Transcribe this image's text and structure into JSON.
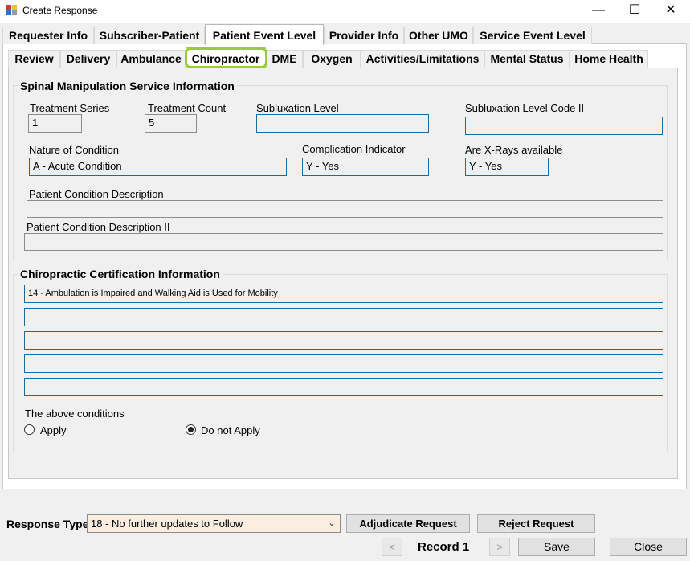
{
  "window": {
    "title": "Create Response",
    "minimize_glyph": "—",
    "maximize_glyph": "☐",
    "close_glyph": "✕",
    "icon": "app-window-icon"
  },
  "top_tabs": [
    {
      "label": "Requester Info",
      "active": false
    },
    {
      "label": "Subscriber-Patient",
      "active": false
    },
    {
      "label": "Patient Event Level",
      "active": true
    },
    {
      "label": "Provider Info",
      "active": false
    },
    {
      "label": "Other UMO",
      "active": false
    },
    {
      "label": "Service Event Level",
      "active": false
    }
  ],
  "sub_tabs": [
    {
      "label": "Review",
      "active": false
    },
    {
      "label": "Delivery",
      "active": false
    },
    {
      "label": "Ambulance",
      "active": false
    },
    {
      "label": "Chiropractor",
      "active": true
    },
    {
      "label": "DME",
      "active": false
    },
    {
      "label": "Oxygen",
      "active": false
    },
    {
      "label": "Activities/Limitations",
      "active": false
    },
    {
      "label": "Mental Status",
      "active": false
    },
    {
      "label": "Home Health",
      "active": false
    }
  ],
  "spinal": {
    "title": "Spinal Manipulation Service Information",
    "treatment_series_label": "Treatment Series",
    "treatment_series_value": "1",
    "treatment_count_label": "Treatment Count",
    "treatment_count_value": "5",
    "subluxation_level_label": "Subluxation Level",
    "subluxation_level_value": "",
    "subluxation_code2_label": "Subluxation Level Code II",
    "subluxation_code2_value": "",
    "nature_label": "Nature of Condition",
    "nature_value": "A - Acute Condition",
    "complication_label": "Complication Indicator",
    "complication_value": "Y - Yes",
    "xrays_label": "Are X-Rays available",
    "xrays_value": "Y - Yes",
    "desc_label": "Patient Condition Description",
    "desc_value": "",
    "desc2_label": "Patient Condition Description II",
    "desc2_value": ""
  },
  "certification": {
    "title": "Chiropractic Certification Information",
    "rows": [
      "14 - Ambulation is Impaired and Walking Aid is Used for Mobility",
      "",
      "",
      "",
      ""
    ],
    "conditions_label": "The above conditions",
    "apply_label": "Apply",
    "apply_selected": false,
    "notapply_label": "Do not Apply",
    "notapply_selected": true
  },
  "footer": {
    "response_type_label": "Response Type",
    "response_type_value": "18 - No further updates to Follow",
    "adjudicate_label": "Adjudicate Request",
    "reject_label": "Reject Request",
    "prev_glyph": "<",
    "next_glyph": ">",
    "record_label": "Record 1",
    "save_label": "Save",
    "close_label": "Close"
  },
  "colors": {
    "field_border": "#1b6b9c",
    "active_highlight": "#9acd32",
    "select_background": "#fbeee0"
  }
}
